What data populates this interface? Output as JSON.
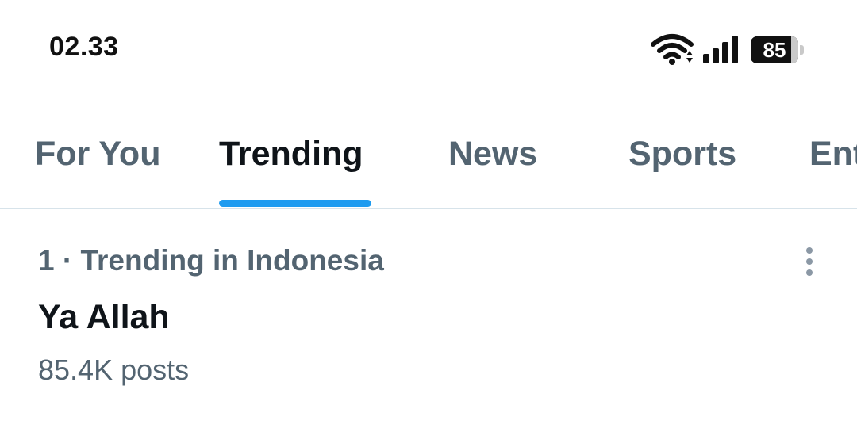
{
  "status_bar": {
    "time": "02.33",
    "battery_level": "85",
    "battery_fraction": 0.85,
    "icons": {
      "wifi": "wifi-icon",
      "signal": "cellular-signal-icon",
      "battery": "battery-icon"
    }
  },
  "tabs": [
    {
      "label": "For You",
      "active": false
    },
    {
      "label": "Trending",
      "active": true
    },
    {
      "label": "News",
      "active": false
    },
    {
      "label": "Sports",
      "active": false
    },
    {
      "label": "Entertainment",
      "active": false
    }
  ],
  "trend": {
    "context": "1 · Trending in Indonesia",
    "title": "Ya Allah",
    "post_count": "85.4K posts",
    "more_icon": "more-vertical-icon"
  },
  "colors": {
    "accent": "#1d9bf0",
    "primary_text": "#0f1419",
    "secondary_text": "#536471",
    "divider": "#d7e3ea"
  }
}
